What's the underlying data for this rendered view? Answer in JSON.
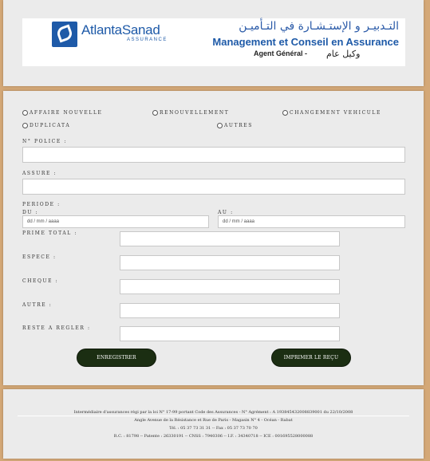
{
  "header": {
    "logo_name": "AtlantaSanad",
    "logo_sub": "ASSURANCE",
    "title_ar": "التـدبيـر و الإستـشـارة في التـأميـن",
    "title_fr": "Management et Conseil en Assurance",
    "agent_fr": "Agent Général  -",
    "agent_ar": "وكيل عام"
  },
  "form": {
    "radios": {
      "affaire_nouvelle": "AFFAIRE NOUVELLE",
      "renouvellement": "RENOUVELLEMENT",
      "changement_vehicule": "CHANGEMENT VEHICULE",
      "duplicata": "DUPLICATA",
      "autres": "AUTRES"
    },
    "labels": {
      "police": "N° POLICE :",
      "assure": "ASSURE :",
      "periode": "PERIODE :",
      "du": "DU :",
      "au": "AU :",
      "prime_total": "PRIME TOTAL :",
      "espece": "ESPECE :",
      "cheque": "CHEQUE :",
      "autre": "AUTRE :",
      "reste": "RESTE A REGLER :"
    },
    "values": {
      "police": "",
      "assure": "",
      "du": "dd / mm / aaaa",
      "au": "dd / mm / aaaa",
      "prime_total": "",
      "espece": "",
      "cheque": "",
      "autre": "",
      "reste": ""
    },
    "buttons": {
      "enregistrer": "ENREGISTRER",
      "imprimer": "IMPRIMER LE REÇU"
    }
  },
  "footer": {
    "line1": "Intermédiaire d'assurances régi par la loi N° 17-99 portant Code des Assurances - N° Agrément : A 193845432008839001 du 22/10/2008",
    "line2": "Angle Avenue de la Résistance et Rue de Paris - Magasin N° 4 - Océan - Rabat",
    "line3": "Tél. : 05 37 73 31 31 -- Fax : 05 37 73 70 70",
    "line4": "R.C. : 81798 -- Patente : 26330191 -- CNSS : 7940306 -- I.F. : 34340718 -- ICE : 001695528000088"
  },
  "colors": {
    "brand": "#1e5aa8",
    "button": "#1b2e12",
    "background": "#d4a877",
    "panel": "#ebebeb"
  }
}
